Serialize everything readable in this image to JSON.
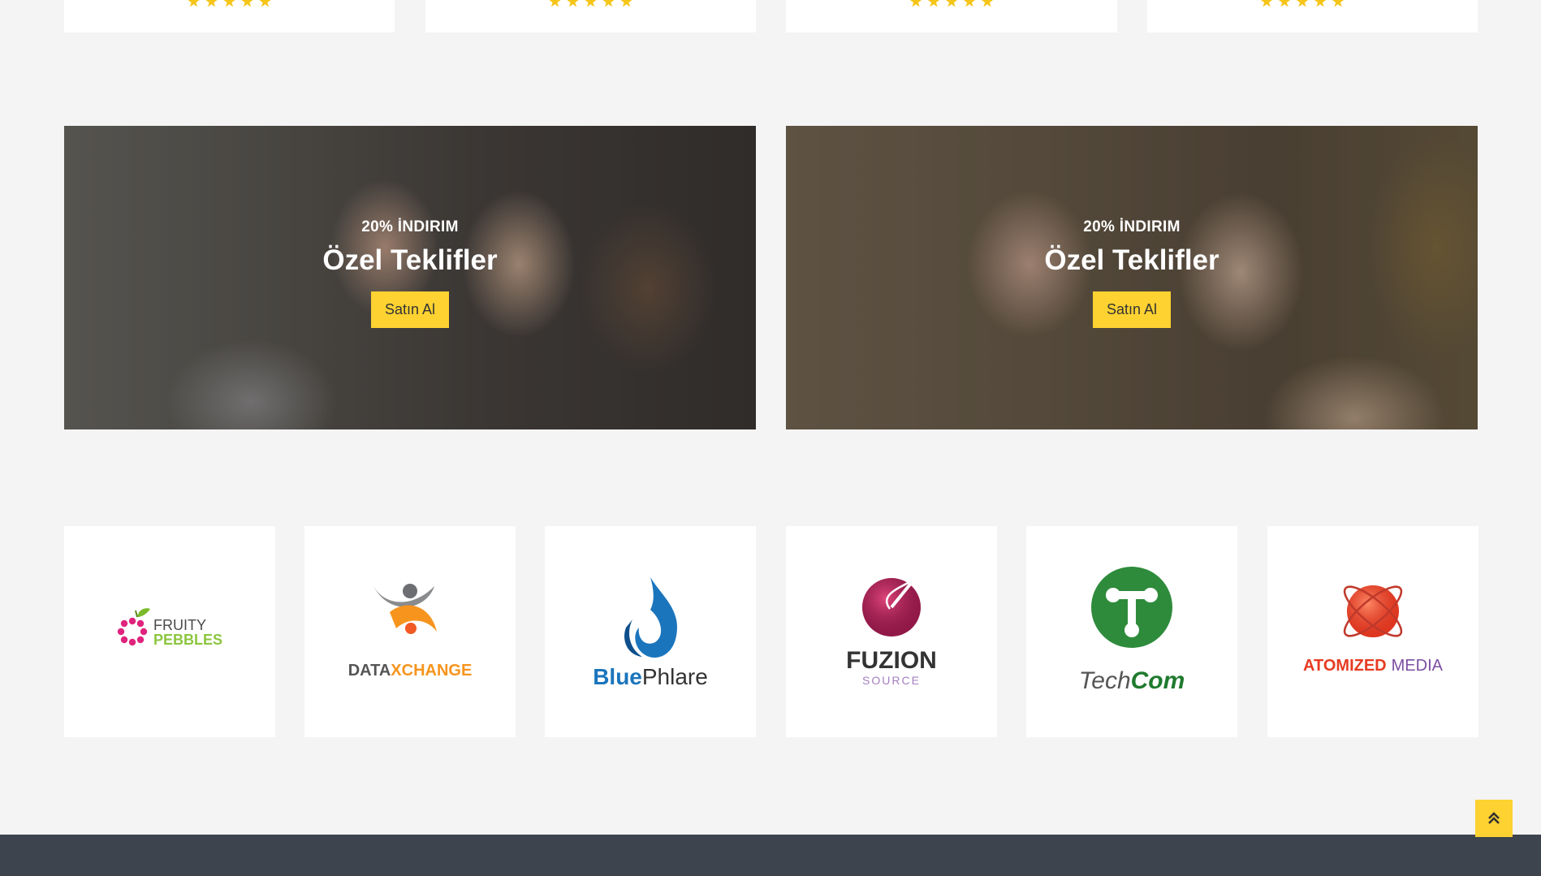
{
  "product_cards": [
    {
      "rating": 5
    },
    {
      "rating": 5
    },
    {
      "rating": 5
    },
    {
      "rating": 5
    }
  ],
  "promo_banners": [
    {
      "discount": "20% İNDIRIM",
      "title": "Özel Teklifler",
      "button": "Satın Al"
    },
    {
      "discount": "20% İNDIRIM",
      "title": "Özel Teklifler",
      "button": "Satın Al"
    }
  ],
  "brands": [
    {
      "name": "FRUITY PEBBLES",
      "line1": "FRUITY",
      "line2": "PEBBLES"
    },
    {
      "name": "DATAXCHANGE",
      "line1": "DATA",
      "line2": "XCHANGE"
    },
    {
      "name": "BluePhlare",
      "line1": "Blue",
      "line2": "Phlare"
    },
    {
      "name": "FUZION SOURCE",
      "line1": "FUZION",
      "line2": "SOURCE"
    },
    {
      "name": "TechCom",
      "line1": "Tech",
      "line2": "Com"
    },
    {
      "name": "ATOMIZED MEDIA",
      "line1": "ATOMIZED",
      "line2": "MEDIA"
    }
  ],
  "back_to_top_icon": "double-chevron-up-icon",
  "colors": {
    "accent": "#fdd231",
    "star": "#f5c518",
    "footer": "#3d444d",
    "page_bg": "#f4f4f4"
  }
}
